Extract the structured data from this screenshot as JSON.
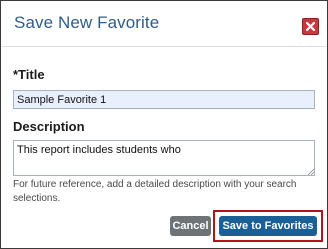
{
  "dialog": {
    "title": "Save New Favorite",
    "close_icon": "close-icon",
    "accent_color": "#2f5d8a",
    "close_color": "#c8383d"
  },
  "form": {
    "title_label": "*Title",
    "title_value": "Sample Favorite 1",
    "description_label": "Description",
    "description_value": "This report includes students who",
    "help_text": "For future reference, add a detailed description with your search selections."
  },
  "footer": {
    "cancel_label": "Cancel",
    "save_label": "Save to Favorites",
    "save_color": "#1b5f97",
    "highlight_color": "#b0151c"
  }
}
